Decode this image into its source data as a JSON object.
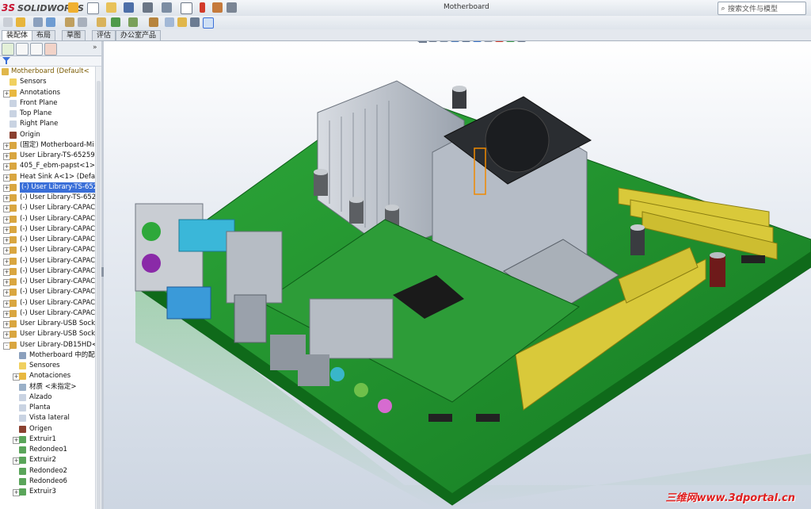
{
  "app": {
    "logo_text": "SOLIDWORKS",
    "logo_mark": "3S",
    "window_title": "Motherboard"
  },
  "search": {
    "placeholder": "搜索文件与模型"
  },
  "tabs": [
    {
      "label": "装配体",
      "active": true
    },
    {
      "label": "布局",
      "active": false
    },
    {
      "label": "草图",
      "active": false
    },
    {
      "label": "评估",
      "active": false
    },
    {
      "label": "办公室产品",
      "active": false
    }
  ],
  "tree": {
    "items": [
      {
        "label": "Motherboard  (Default<",
        "indent": 0,
        "icon": "assembly-icon",
        "root": true
      },
      {
        "label": "Sensors",
        "indent": 1,
        "icon": "sensor-icon"
      },
      {
        "label": "Annotations",
        "indent": 1,
        "icon": "annotation-icon",
        "expander": "+"
      },
      {
        "label": "Front Plane",
        "indent": 1,
        "icon": "plane-icon"
      },
      {
        "label": "Top Plane",
        "indent": 1,
        "icon": "plane-icon"
      },
      {
        "label": "Right Plane",
        "indent": 1,
        "icon": "plane-icon"
      },
      {
        "label": "Origin",
        "indent": 1,
        "icon": "origin-icon"
      },
      {
        "label": "(固定) Motherboard-Mi",
        "indent": 1,
        "icon": "part-icon",
        "expander": "+"
      },
      {
        "label": "User Library-TS-65259-2",
        "indent": 1,
        "icon": "part-icon",
        "expander": "+"
      },
      {
        "label": "405_F_ebm-papst<1> (",
        "indent": 1,
        "icon": "part-icon",
        "expander": "+"
      },
      {
        "label": "Heat Sink A<1> (Defaul",
        "indent": 1,
        "icon": "part-icon",
        "expander": "+"
      },
      {
        "label": "(-) User Library-TS-6525",
        "indent": 1,
        "icon": "part-icon",
        "expander": "+",
        "selected": true
      },
      {
        "label": "(-) User Library-TS-6525",
        "indent": 1,
        "icon": "part-icon",
        "expander": "+"
      },
      {
        "label": "(-) User Library-CAPACI",
        "indent": 1,
        "icon": "part-icon",
        "expander": "+"
      },
      {
        "label": "(-) User Library-CAPACI",
        "indent": 1,
        "icon": "part-icon",
        "expander": "+"
      },
      {
        "label": "(-) User Library-CAPACI",
        "indent": 1,
        "icon": "part-icon",
        "expander": "+"
      },
      {
        "label": "(-) User Library-CAPACI",
        "indent": 1,
        "icon": "part-icon",
        "expander": "+"
      },
      {
        "label": "(-) User Library-CAPACI",
        "indent": 1,
        "icon": "part-icon",
        "expander": "+"
      },
      {
        "label": "(-) User Library-CAPACI",
        "indent": 1,
        "icon": "part-icon",
        "expander": "+"
      },
      {
        "label": "(-) User Library-CAPACI",
        "indent": 1,
        "icon": "part-icon",
        "expander": "+"
      },
      {
        "label": "(-) User Library-CAPACI",
        "indent": 1,
        "icon": "part-icon",
        "expander": "+"
      },
      {
        "label": "(-) User Library-CAPACI",
        "indent": 1,
        "icon": "part-icon",
        "expander": "+"
      },
      {
        "label": "(-) User Library-CAPACI",
        "indent": 1,
        "icon": "part-icon",
        "expander": "+"
      },
      {
        "label": "(-) User Library-CAPACI",
        "indent": 1,
        "icon": "part-icon",
        "expander": "+"
      },
      {
        "label": "User Library-USB Socke",
        "indent": 1,
        "icon": "part-icon",
        "expander": "+"
      },
      {
        "label": "User Library-USB Socke",
        "indent": 1,
        "icon": "part-icon",
        "expander": "+"
      },
      {
        "label": "User Library-DB15HD<1",
        "indent": 1,
        "icon": "part-icon",
        "expander": "-"
      },
      {
        "label": "Motherboard 中的配",
        "indent": 2,
        "icon": "mates-icon"
      },
      {
        "label": "Sensores",
        "indent": 2,
        "icon": "sensor-icon"
      },
      {
        "label": "Anotaciones",
        "indent": 2,
        "icon": "annotation-icon",
        "expander": "+"
      },
      {
        "label": "材质 <未指定>",
        "indent": 2,
        "icon": "material-icon"
      },
      {
        "label": "Alzado",
        "indent": 2,
        "icon": "plane-icon"
      },
      {
        "label": "Planta",
        "indent": 2,
        "icon": "plane-icon"
      },
      {
        "label": "Vista lateral",
        "indent": 2,
        "icon": "plane-icon"
      },
      {
        "label": "Origen",
        "indent": 2,
        "icon": "origin-icon"
      },
      {
        "label": "Extruir1",
        "indent": 2,
        "icon": "feature-icon",
        "expander": "+"
      },
      {
        "label": "Redondeo1",
        "indent": 2,
        "icon": "feature-icon"
      },
      {
        "label": "Extruir2",
        "indent": 2,
        "icon": "feature-icon",
        "expander": "+"
      },
      {
        "label": "Redondeo2",
        "indent": 2,
        "icon": "feature-icon"
      },
      {
        "label": "Redondeo6",
        "indent": 2,
        "icon": "feature-icon"
      },
      {
        "label": "Extruir3",
        "indent": 2,
        "icon": "feature-icon",
        "expander": "+"
      }
    ]
  },
  "watermark": {
    "text": "三维网www.3dportal.cn"
  },
  "colors": {
    "accent": "#3a6fd8",
    "pcb": "#1f8a2a",
    "slot": "#d9c93a",
    "watermark": "#e02020"
  }
}
